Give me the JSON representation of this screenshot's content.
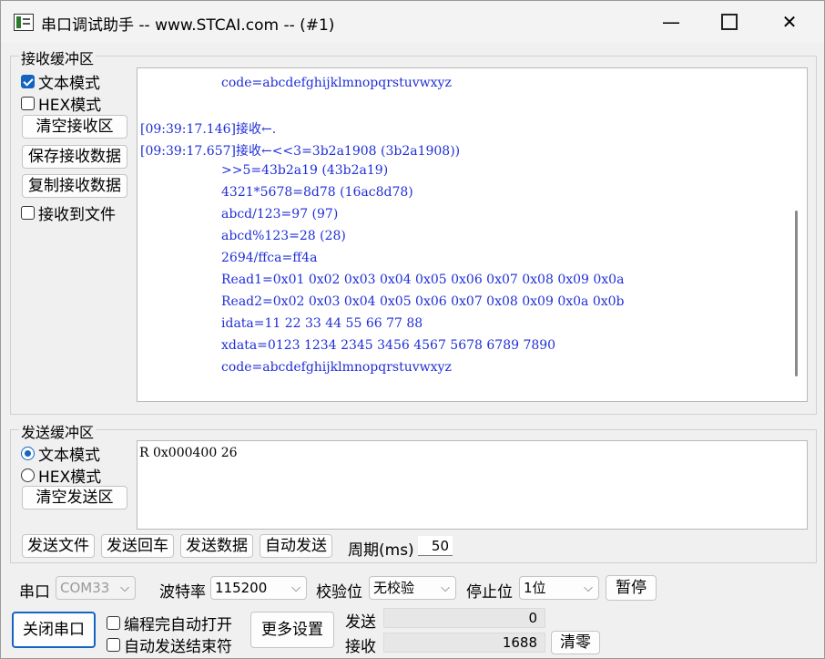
{
  "window": {
    "title": "串口调试助手 -- www.STCAI.com -- (#1)",
    "min_glyph": "—",
    "close_glyph": "✕"
  },
  "receive": {
    "legend": "接收缓冲区",
    "text_mode_label": "文本模式",
    "text_mode_checked": true,
    "hex_mode_label": "HEX模式",
    "hex_mode_checked": false,
    "clear_button": "清空接收区",
    "save_button": "保存接收数据",
    "copy_button": "复制接收数据",
    "to_file_label": "接收到文件",
    "to_file_checked": false,
    "lines": [
      "                    code=abcdefghijklmnopqrstuvwxyz",
      "",
      "[09:39:17.146]接收←.",
      "[09:39:17.657]接收←<<3=3b2a1908 (3b2a1908))",
      "                    >>5=43b2a19 (43b2a19)",
      "                    4321*5678=8d78 (16ac8d78)",
      "                    abcd/123=97 (97)",
      "                    abcd%123=28 (28)",
      "                    2694/ffca=ff4a",
      "                    Read1=0x01 0x02 0x03 0x04 0x05 0x06 0x07 0x08 0x09 0x0a",
      "                    Read2=0x02 0x03 0x04 0x05 0x06 0x07 0x08 0x09 0x0a 0x0b",
      "                    idata=11 22 33 44 55 66 77 88",
      "                    xdata=0123 1234 2345 3456 4567 5678 6789 7890",
      "                    code=abcdefghijklmnopqrstuvwxyz"
    ]
  },
  "send": {
    "legend": "发送缓冲区",
    "text_mode_label": "文本模式",
    "text_mode_selected": true,
    "hex_mode_label": "HEX模式",
    "clear_button": "清空发送区",
    "content": "R 0x000400 26",
    "send_file_button": "发送文件",
    "send_enter_button": "发送回车",
    "send_data_button": "发送数据",
    "auto_send_button": "自动发送",
    "period_label": "周期(ms)",
    "period_value": "50"
  },
  "serial": {
    "port_label": "串口",
    "port_value": "COM33",
    "baud_label": "波特率",
    "baud_value": "115200",
    "parity_label": "校验位",
    "parity_value": "无校验",
    "stopbits_label": "停止位",
    "stopbits_value": "1位",
    "pause_button": "暂停",
    "close_port_button": "关闭串口",
    "auto_open_label": "编程完自动打开",
    "auto_end_label": "自动发送结束符",
    "more_settings_button": "更多设置",
    "sent_label": "发送",
    "sent_value": "0",
    "recv_label": "接收",
    "recv_value": "1688",
    "clear_counts_button": "清零"
  }
}
